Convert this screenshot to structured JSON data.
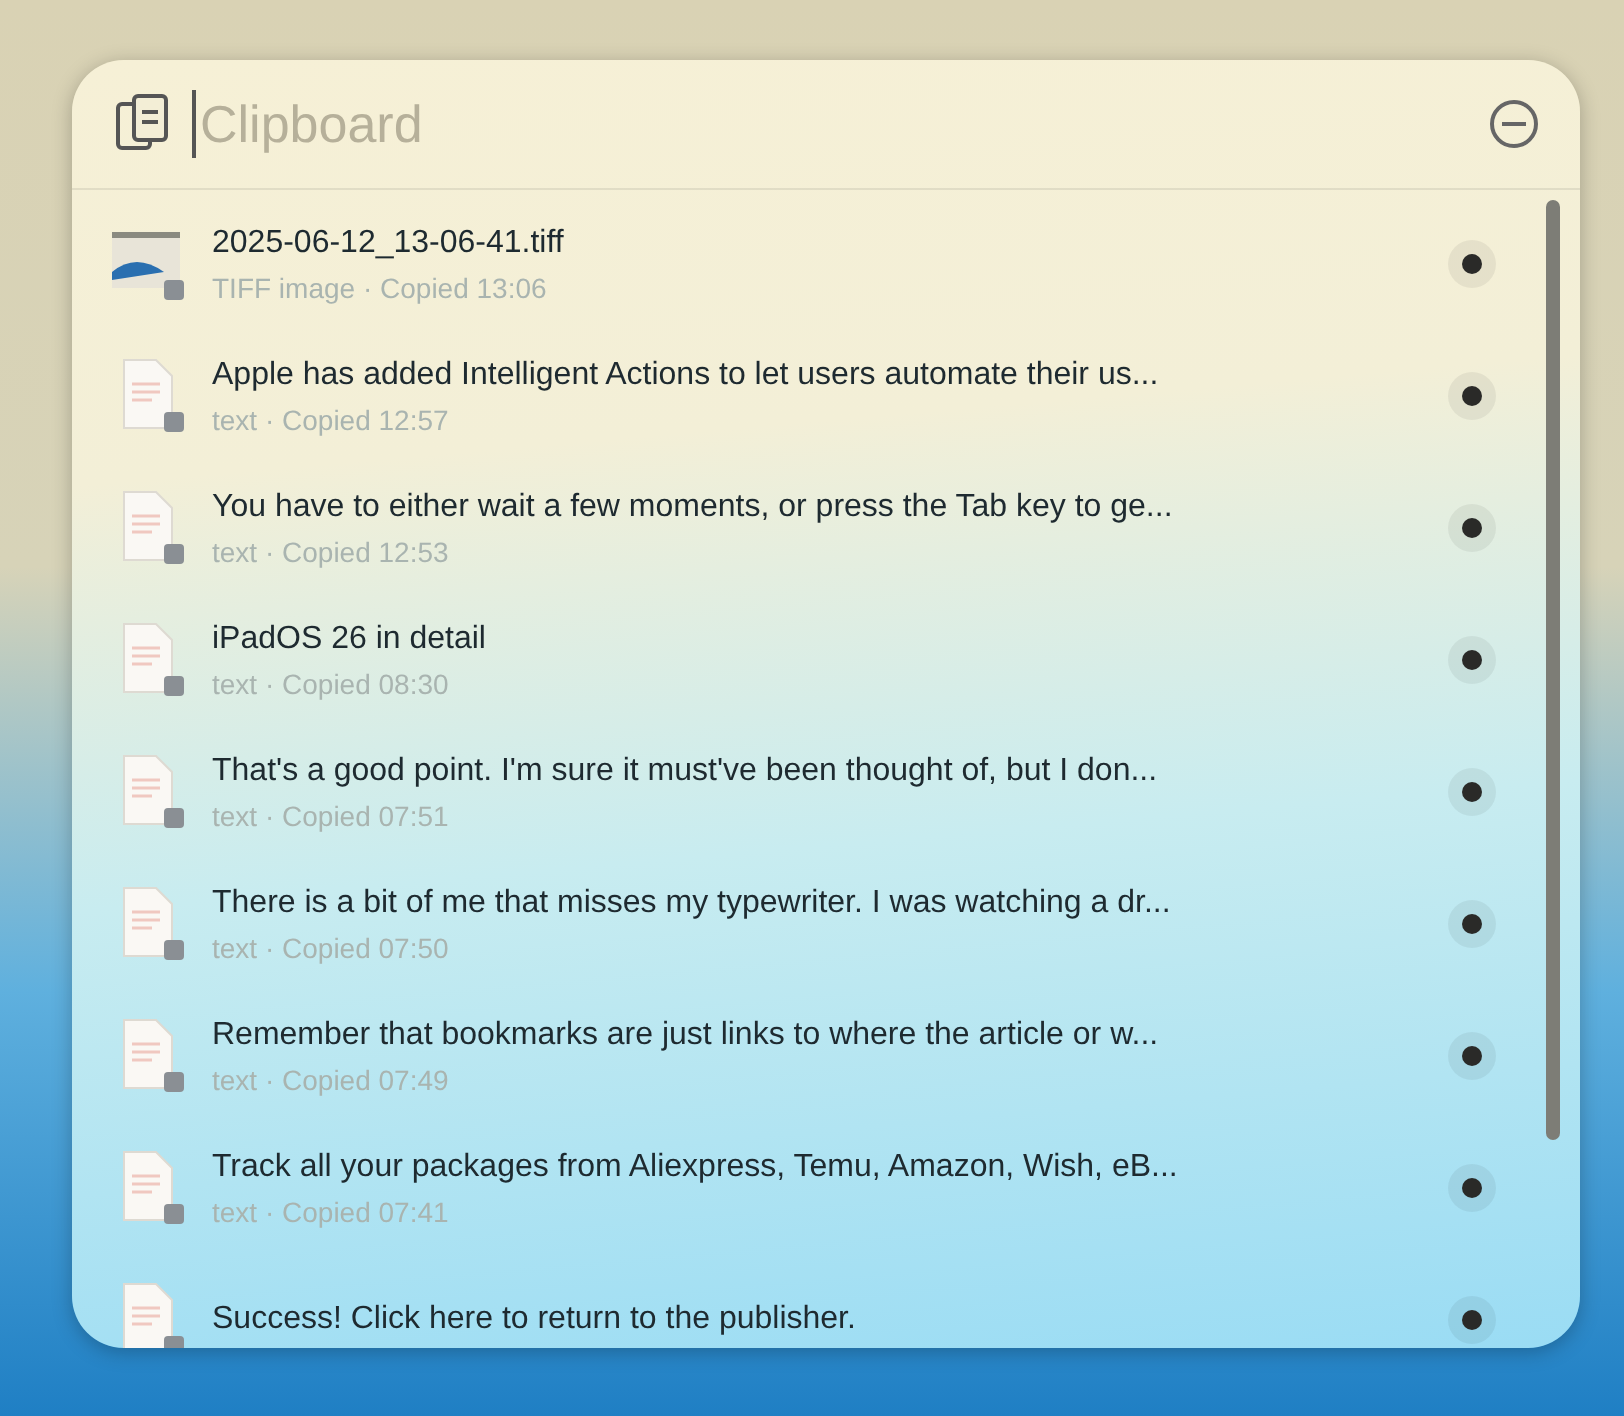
{
  "search": {
    "placeholder": "Clipboard"
  },
  "items": [
    {
      "kind": "image",
      "title": "2025-06-12_13-06-41.tiff",
      "subtitle": "TIFF image · Copied 13:06"
    },
    {
      "kind": "text",
      "title": "Apple has added Intelligent Actions to let users automate their us...",
      "subtitle": "text · Copied 12:57"
    },
    {
      "kind": "text",
      "title": "You have to either wait a few moments, or press the Tab key to ge...",
      "subtitle": "text · Copied 12:53"
    },
    {
      "kind": "text",
      "title": "iPadOS 26 in detail",
      "subtitle": "text · Copied 08:30"
    },
    {
      "kind": "text",
      "title": "That's a good point. I'm sure it must've been thought of, but I don...",
      "subtitle": "text · Copied 07:51"
    },
    {
      "kind": "text",
      "title": "There is a bit of me that misses my typewriter. I was watching a dr...",
      "subtitle": "text · Copied 07:50"
    },
    {
      "kind": "text",
      "title": "Remember that bookmarks are just links to where the article or w...",
      "subtitle": "text · Copied 07:49"
    },
    {
      "kind": "text",
      "title": "Track all your packages from Aliexpress, Temu, Amazon, Wish, eB...",
      "subtitle": "text · Copied 07:41"
    },
    {
      "kind": "text",
      "title": "Success! Click here to return to the publisher."
    }
  ]
}
